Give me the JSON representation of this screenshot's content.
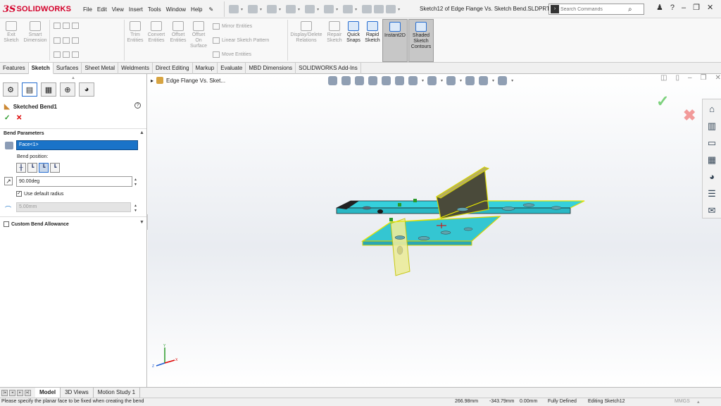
{
  "app": {
    "brand_ds": "3S",
    "brand_name": "SOLIDWORKS",
    "menus": [
      "File",
      "Edit",
      "View",
      "Insert",
      "Tools",
      "Window",
      "Help"
    ],
    "doc_title": "Sketch12 of Edge Flange Vs. Sketch Bend.SLDPRT *",
    "search_placeholder": "Search Commands",
    "help_label": "?"
  },
  "ribbon": {
    "exit_sketch": "Exit Sketch",
    "smart_dimension": "Smart Dimension",
    "trim_entities": "Trim Entities",
    "convert_entities": "Convert Entities",
    "offset_entities": "Offset Entities",
    "offset_on_surface": "Offset On Surface",
    "mirror_entities": "Mirror Entities",
    "linear_sketch_pattern": "Linear Sketch Pattern",
    "move_entities": "Move Entities",
    "display_delete_relations": "Display/Delete Relations",
    "repair_sketch": "Repair Sketch",
    "quick_snaps": "Quick Snaps",
    "rapid_sketch": "Rapid Sketch",
    "instant2d": "Instant2D",
    "shaded_sketch_contours": "Shaded Sketch Contours"
  },
  "tabs": [
    "Features",
    "Sketch",
    "Surfaces",
    "Sheet Metal",
    "Weldments",
    "Direct Editing",
    "Markup",
    "Evaluate",
    "MBD Dimensions",
    "SOLIDWORKS Add-Ins"
  ],
  "selected_tab": "Sketch",
  "property_manager": {
    "title": "Sketched Bend1",
    "section_bend_parameters": "Bend Parameters",
    "face_selection": "Face<1>",
    "bend_position_label": "Bend position:",
    "bend_angle": "90.00deg",
    "use_default_radius": "Use default radius",
    "use_default_radius_checked": true,
    "radius_value": "5.00mm",
    "custom_bend_allowance": "Custom Bend Allowance",
    "custom_bend_allowance_checked": false
  },
  "viewport": {
    "breadcrumb": "Edge Flange Vs. Sket..."
  },
  "bottom_tabs": [
    "Model",
    "3D Views",
    "Motion Study 1"
  ],
  "selected_bottom_tab": "Model",
  "status": {
    "message": "Please specify the planar face to be fixed when creating the bend",
    "x": "266.98mm",
    "y": "-343.79mm",
    "z": "0.00mm",
    "sketch_state": "Fully Defined",
    "editing": "Editing Sketch12",
    "units": "MMGS"
  },
  "colors": {
    "brand_red": "#d4002a",
    "selection_blue": "#1a73c8",
    "part_cyan": "#2ec7d4",
    "edge_yellow": "#e6e600"
  }
}
